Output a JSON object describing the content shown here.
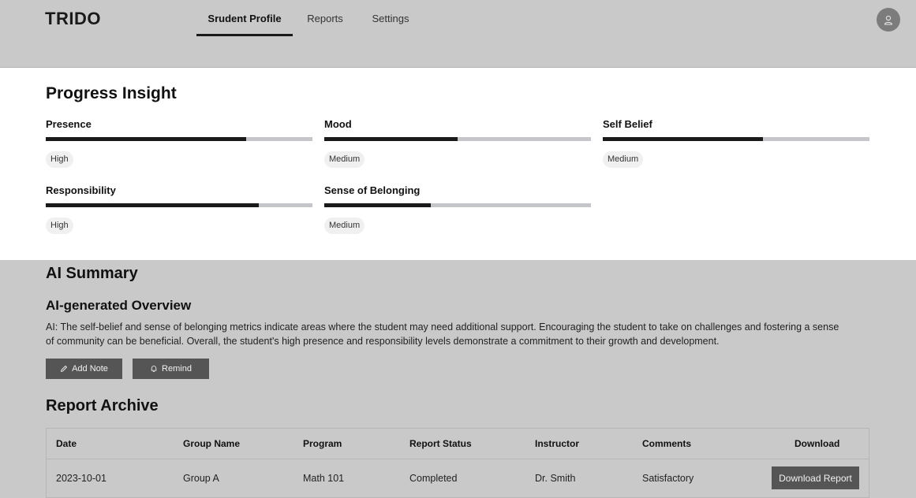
{
  "app": {
    "logo": "TRIDO"
  },
  "nav": {
    "tabs": [
      {
        "label": "Srudent Profile",
        "active": true
      },
      {
        "label": "Reports",
        "active": false
      },
      {
        "label": "Settings",
        "active": false
      }
    ],
    "avatar_icon": "user-icon"
  },
  "progress": {
    "title": "Progress Insight",
    "metrics": [
      {
        "label": "Presence",
        "level": "High",
        "progress": 0.75
      },
      {
        "label": "Mood",
        "level": "Medium",
        "progress": 0.5
      },
      {
        "label": "Self Belief",
        "level": "Medium",
        "progress": 0.6
      },
      {
        "label": "Responsibility",
        "level": "High",
        "progress": 0.8
      },
      {
        "label": "Sense of Belonging",
        "level": "Medium",
        "progress": 0.4
      }
    ]
  },
  "summary": {
    "title": "AI Summary",
    "subtitle": "AI-generated Overview",
    "text": "AI: The self-belief and sense of belonging metrics indicate areas where the student may need additional support. Encouraging the student to take on challenges and fostering a sense of community can be beneficial. Overall, the student's high presence and responsibility levels demonstrate a commitment to their growth and development.",
    "buttons": {
      "add_note": "Add Note",
      "add_note_icon": "pencil-icon",
      "remind": "Remind",
      "remind_icon": "bell-icon"
    }
  },
  "archive": {
    "title": "Report Archive",
    "columns": [
      "Date",
      "Group Name",
      "Program",
      "Report Status",
      "Instructor",
      "Comments",
      "Download"
    ],
    "rows": [
      {
        "date": "2023-10-01",
        "group": "Group A",
        "program": "Math 101",
        "status": "Completed",
        "instructor": "Dr. Smith",
        "comments": "Satisfactory",
        "download": "Download Report"
      }
    ]
  },
  "colors": {
    "background": "#c9c9c9",
    "panel": "#ffffff",
    "progress_fill": "#1a1a1a",
    "progress_track": "#c4c6c9",
    "button": "#555555"
  }
}
